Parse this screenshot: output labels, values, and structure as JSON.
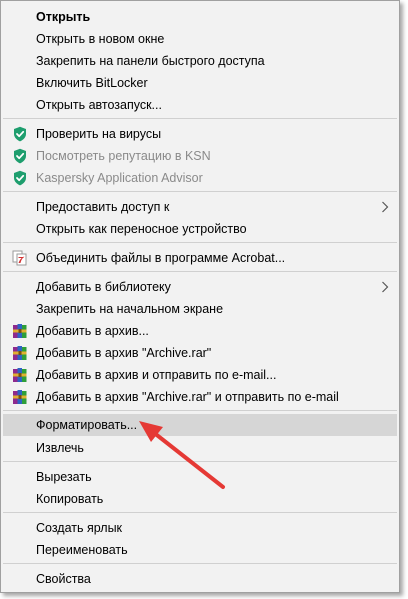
{
  "menu": {
    "items": {
      "open": "Открыть",
      "open_new_window": "Открыть в новом окне",
      "pin_quick_access": "Закрепить на панели быстрого доступа",
      "enable_bitlocker": "Включить BitLocker",
      "open_autoplay": "Открыть автозапуск...",
      "scan_viruses": "Проверить на вирусы",
      "ksn_reputation": "Посмотреть репутацию в KSN",
      "kaspersky_advisor": "Kaspersky Application Advisor",
      "give_access": "Предоставить доступ к",
      "open_portable": "Открыть как переносное устройство",
      "acrobat_combine": "Объединить файлы в программе Acrobat...",
      "add_library": "Добавить в библиотеку",
      "pin_start": "Закрепить на начальном экране",
      "add_archive": "Добавить в архив...",
      "add_archive_rar": "Добавить в архив \"Archive.rar\"",
      "add_archive_email": "Добавить в архив и отправить по e-mail...",
      "add_archive_rar_email": "Добавить в архив \"Archive.rar\" и отправить по e-mail",
      "format": "Форматировать...",
      "eject": "Извлечь",
      "cut": "Вырезать",
      "copy": "Копировать",
      "create_shortcut": "Создать ярлык",
      "rename": "Переименовать",
      "properties": "Свойства"
    }
  },
  "colors": {
    "menu_bg": "#f2f2f2",
    "hover_bg": "#d6d6d6",
    "kaspersky_green": "#1e9e6e",
    "annotation_arrow": "#e53935",
    "disabled_text": "#8a8a8a"
  },
  "icons": {
    "kaspersky": "shield-check-icon",
    "acrobat": "acrobat-combine-icon",
    "winrar": "winrar-books-icon",
    "submenu": "chevron-right-icon"
  }
}
